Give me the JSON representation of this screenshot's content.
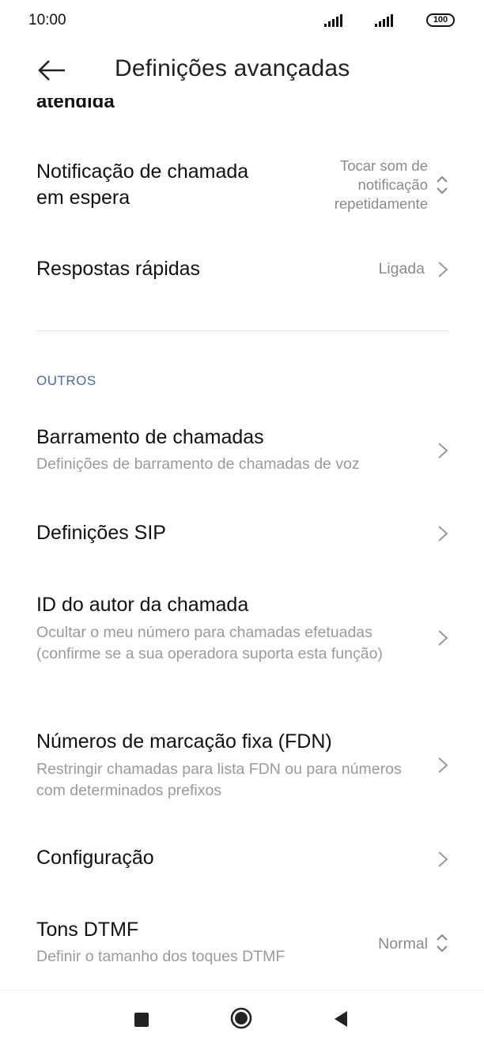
{
  "status_bar": {
    "time": "10:00",
    "battery": "100"
  },
  "header": {
    "title": "Definições avançadas"
  },
  "content": {
    "clipped_item_text": "atendida",
    "call_waiting": {
      "title": "Notificação de chamada em espera",
      "value": "Tocar som de notificação repetidamente"
    },
    "quick_responses": {
      "title": "Respostas rápidas",
      "value": "Ligada"
    },
    "section_others": "OUTROS",
    "call_barring": {
      "title": "Barramento de chamadas",
      "subtitle": "Definições de barramento de chamadas de voz"
    },
    "sip_settings": {
      "title": "Definições SIP"
    },
    "caller_id": {
      "title": "ID do autor da chamada",
      "subtitle": "Ocultar o meu número para chamadas efetuadas (confirme se a sua operadora suporta esta função)"
    },
    "fdn": {
      "title": "Números de marcação fixa (FDN)",
      "subtitle": "Restringir chamadas para lista FDN ou para números com determinados prefixos"
    },
    "configuration": {
      "title": "Configuração"
    },
    "dtmf": {
      "title": "Tons DTMF",
      "subtitle": "Definir o tamanho dos toques DTMF",
      "value": "Normal"
    }
  },
  "icons": {
    "back": "arrow-left-icon",
    "chevron": "chevron-right-icon",
    "updown": "chevron-up-down-icon",
    "signal": "signal-bars-icon",
    "battery": "battery-icon",
    "nav_recents": "square-icon",
    "nav_home": "circle-icon",
    "nav_back": "triangle-back-icon"
  },
  "colors": {
    "section_header": "#4c6aa8",
    "secondary_text": "#9a9a9a"
  }
}
